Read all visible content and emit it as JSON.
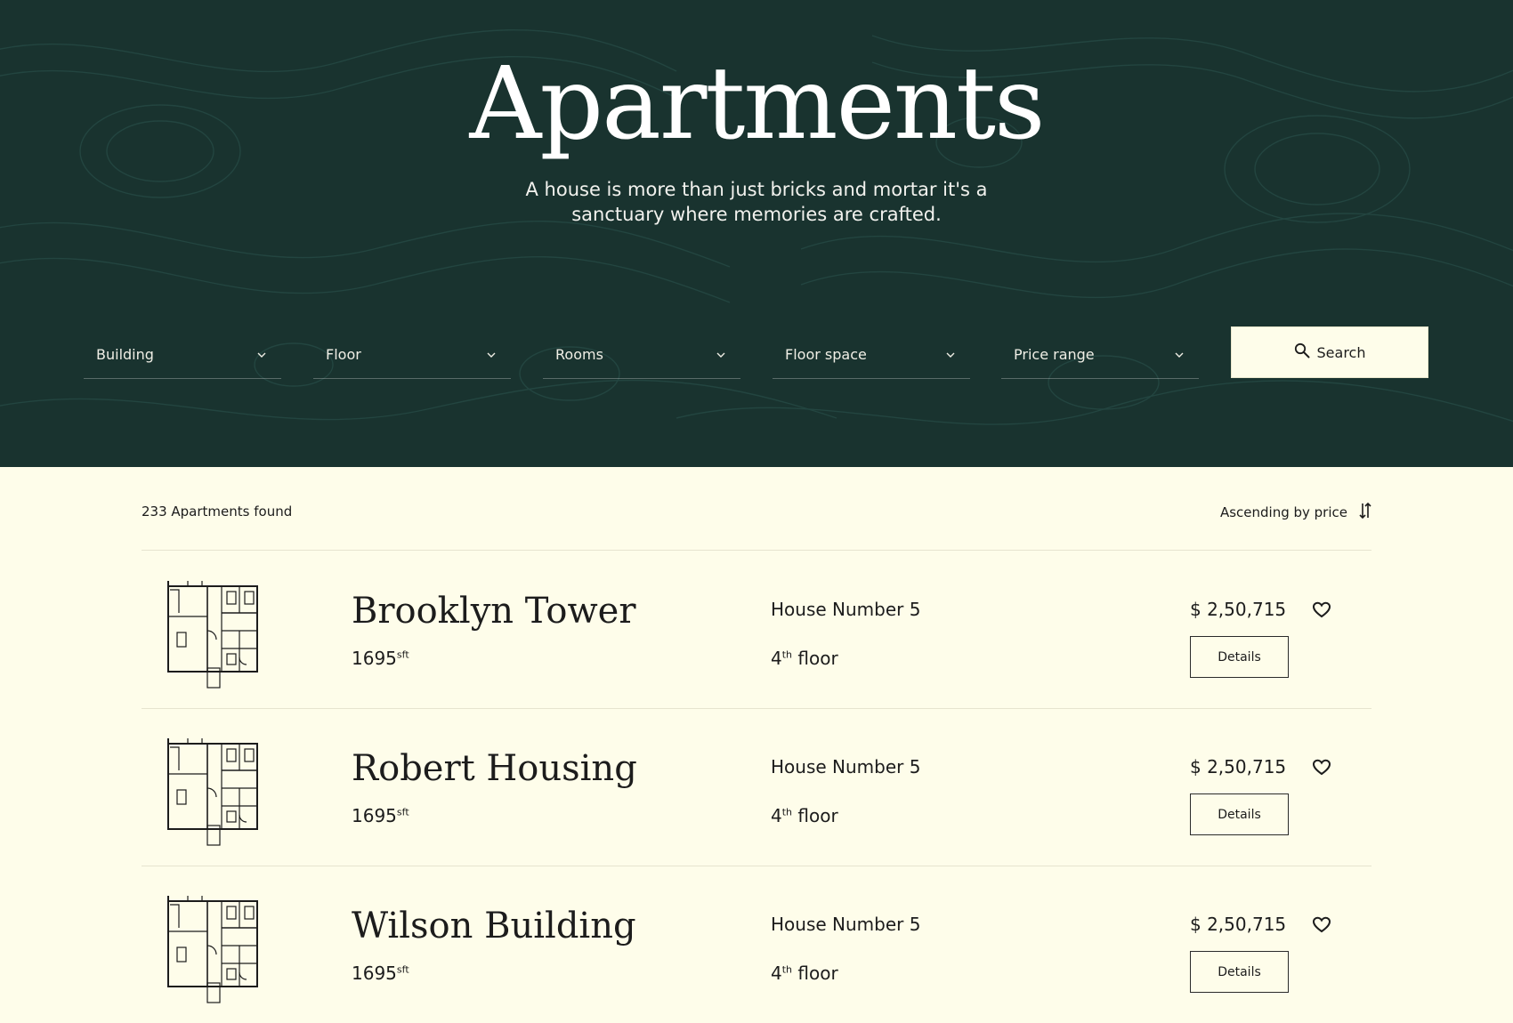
{
  "hero": {
    "title": "Apartments",
    "subtitle": "A house is more than just bricks and mortar it's a sanctuary where memories are crafted."
  },
  "filters": [
    {
      "label": "Building"
    },
    {
      "label": "Floor"
    },
    {
      "label": "Rooms"
    },
    {
      "label": "Floor space"
    },
    {
      "label": "Price range"
    }
  ],
  "search": {
    "label": "Search"
  },
  "results": {
    "count_text": "233 Apartments found",
    "sort_label": "Ascending by price"
  },
  "apartments": [
    {
      "name": "Brooklyn Tower",
      "area": "1695",
      "area_unit": "sft",
      "house": "House Number 5",
      "floor_num": "4",
      "floor_suffix": "th",
      "floor_word": "floor",
      "price": "$ 2,50,715",
      "details_label": "Details"
    },
    {
      "name": "Robert Housing",
      "area": "1695",
      "area_unit": "sft",
      "house": "House Number 5",
      "floor_num": "4",
      "floor_suffix": "th",
      "floor_word": "floor",
      "price": "$ 2,50,715",
      "details_label": "Details"
    },
    {
      "name": "Wilson Building",
      "area": "1695",
      "area_unit": "sft",
      "house": "House Number 5",
      "floor_num": "4",
      "floor_suffix": "th",
      "floor_word": "floor",
      "price": "$ 2,50,715",
      "details_label": "Details"
    }
  ],
  "icons": {
    "filter_chevron": "chevron-down-icon",
    "search": "search-icon",
    "sort": "sort-icon",
    "favorite": "heart-icon",
    "floor_plan": "floor-plan-icon"
  },
  "colors": {
    "hero_bg": "#19332f",
    "page_bg": "#fefdea",
    "text": "#1c1c1c"
  }
}
